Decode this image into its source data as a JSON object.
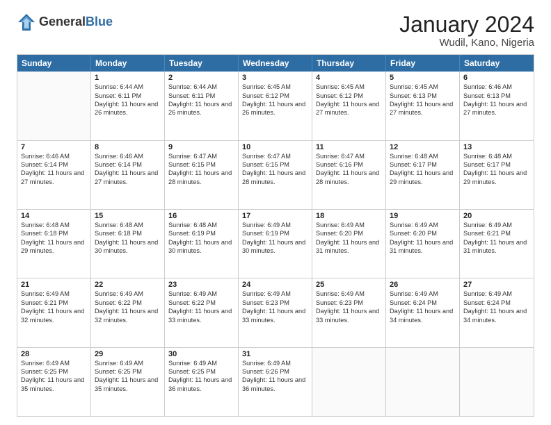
{
  "header": {
    "logo_general": "General",
    "logo_blue": "Blue",
    "month_title": "January 2024",
    "location": "Wudil, Kano, Nigeria"
  },
  "weekdays": [
    "Sunday",
    "Monday",
    "Tuesday",
    "Wednesday",
    "Thursday",
    "Friday",
    "Saturday"
  ],
  "rows": [
    [
      {
        "day": "",
        "sunrise": "",
        "sunset": "",
        "daylight": "",
        "empty": true
      },
      {
        "day": "1",
        "sunrise": "Sunrise: 6:44 AM",
        "sunset": "Sunset: 6:11 PM",
        "daylight": "Daylight: 11 hours and 26 minutes."
      },
      {
        "day": "2",
        "sunrise": "Sunrise: 6:44 AM",
        "sunset": "Sunset: 6:11 PM",
        "daylight": "Daylight: 11 hours and 26 minutes."
      },
      {
        "day": "3",
        "sunrise": "Sunrise: 6:45 AM",
        "sunset": "Sunset: 6:12 PM",
        "daylight": "Daylight: 11 hours and 26 minutes."
      },
      {
        "day": "4",
        "sunrise": "Sunrise: 6:45 AM",
        "sunset": "Sunset: 6:12 PM",
        "daylight": "Daylight: 11 hours and 27 minutes."
      },
      {
        "day": "5",
        "sunrise": "Sunrise: 6:45 AM",
        "sunset": "Sunset: 6:13 PM",
        "daylight": "Daylight: 11 hours and 27 minutes."
      },
      {
        "day": "6",
        "sunrise": "Sunrise: 6:46 AM",
        "sunset": "Sunset: 6:13 PM",
        "daylight": "Daylight: 11 hours and 27 minutes."
      }
    ],
    [
      {
        "day": "7",
        "sunrise": "Sunrise: 6:46 AM",
        "sunset": "Sunset: 6:14 PM",
        "daylight": "Daylight: 11 hours and 27 minutes."
      },
      {
        "day": "8",
        "sunrise": "Sunrise: 6:46 AM",
        "sunset": "Sunset: 6:14 PM",
        "daylight": "Daylight: 11 hours and 27 minutes."
      },
      {
        "day": "9",
        "sunrise": "Sunrise: 6:47 AM",
        "sunset": "Sunset: 6:15 PM",
        "daylight": "Daylight: 11 hours and 28 minutes."
      },
      {
        "day": "10",
        "sunrise": "Sunrise: 6:47 AM",
        "sunset": "Sunset: 6:15 PM",
        "daylight": "Daylight: 11 hours and 28 minutes."
      },
      {
        "day": "11",
        "sunrise": "Sunrise: 6:47 AM",
        "sunset": "Sunset: 6:16 PM",
        "daylight": "Daylight: 11 hours and 28 minutes."
      },
      {
        "day": "12",
        "sunrise": "Sunrise: 6:48 AM",
        "sunset": "Sunset: 6:17 PM",
        "daylight": "Daylight: 11 hours and 29 minutes."
      },
      {
        "day": "13",
        "sunrise": "Sunrise: 6:48 AM",
        "sunset": "Sunset: 6:17 PM",
        "daylight": "Daylight: 11 hours and 29 minutes."
      }
    ],
    [
      {
        "day": "14",
        "sunrise": "Sunrise: 6:48 AM",
        "sunset": "Sunset: 6:18 PM",
        "daylight": "Daylight: 11 hours and 29 minutes."
      },
      {
        "day": "15",
        "sunrise": "Sunrise: 6:48 AM",
        "sunset": "Sunset: 6:18 PM",
        "daylight": "Daylight: 11 hours and 30 minutes."
      },
      {
        "day": "16",
        "sunrise": "Sunrise: 6:48 AM",
        "sunset": "Sunset: 6:19 PM",
        "daylight": "Daylight: 11 hours and 30 minutes."
      },
      {
        "day": "17",
        "sunrise": "Sunrise: 6:49 AM",
        "sunset": "Sunset: 6:19 PM",
        "daylight": "Daylight: 11 hours and 30 minutes."
      },
      {
        "day": "18",
        "sunrise": "Sunrise: 6:49 AM",
        "sunset": "Sunset: 6:20 PM",
        "daylight": "Daylight: 11 hours and 31 minutes."
      },
      {
        "day": "19",
        "sunrise": "Sunrise: 6:49 AM",
        "sunset": "Sunset: 6:20 PM",
        "daylight": "Daylight: 11 hours and 31 minutes."
      },
      {
        "day": "20",
        "sunrise": "Sunrise: 6:49 AM",
        "sunset": "Sunset: 6:21 PM",
        "daylight": "Daylight: 11 hours and 31 minutes."
      }
    ],
    [
      {
        "day": "21",
        "sunrise": "Sunrise: 6:49 AM",
        "sunset": "Sunset: 6:21 PM",
        "daylight": "Daylight: 11 hours and 32 minutes."
      },
      {
        "day": "22",
        "sunrise": "Sunrise: 6:49 AM",
        "sunset": "Sunset: 6:22 PM",
        "daylight": "Daylight: 11 hours and 32 minutes."
      },
      {
        "day": "23",
        "sunrise": "Sunrise: 6:49 AM",
        "sunset": "Sunset: 6:22 PM",
        "daylight": "Daylight: 11 hours and 33 minutes."
      },
      {
        "day": "24",
        "sunrise": "Sunrise: 6:49 AM",
        "sunset": "Sunset: 6:23 PM",
        "daylight": "Daylight: 11 hours and 33 minutes."
      },
      {
        "day": "25",
        "sunrise": "Sunrise: 6:49 AM",
        "sunset": "Sunset: 6:23 PM",
        "daylight": "Daylight: 11 hours and 33 minutes."
      },
      {
        "day": "26",
        "sunrise": "Sunrise: 6:49 AM",
        "sunset": "Sunset: 6:24 PM",
        "daylight": "Daylight: 11 hours and 34 minutes."
      },
      {
        "day": "27",
        "sunrise": "Sunrise: 6:49 AM",
        "sunset": "Sunset: 6:24 PM",
        "daylight": "Daylight: 11 hours and 34 minutes."
      }
    ],
    [
      {
        "day": "28",
        "sunrise": "Sunrise: 6:49 AM",
        "sunset": "Sunset: 6:25 PM",
        "daylight": "Daylight: 11 hours and 35 minutes."
      },
      {
        "day": "29",
        "sunrise": "Sunrise: 6:49 AM",
        "sunset": "Sunset: 6:25 PM",
        "daylight": "Daylight: 11 hours and 35 minutes."
      },
      {
        "day": "30",
        "sunrise": "Sunrise: 6:49 AM",
        "sunset": "Sunset: 6:25 PM",
        "daylight": "Daylight: 11 hours and 36 minutes."
      },
      {
        "day": "31",
        "sunrise": "Sunrise: 6:49 AM",
        "sunset": "Sunset: 6:26 PM",
        "daylight": "Daylight: 11 hours and 36 minutes."
      },
      {
        "day": "",
        "sunrise": "",
        "sunset": "",
        "daylight": "",
        "empty": true
      },
      {
        "day": "",
        "sunrise": "",
        "sunset": "",
        "daylight": "",
        "empty": true
      },
      {
        "day": "",
        "sunrise": "",
        "sunset": "",
        "daylight": "",
        "empty": true
      }
    ]
  ]
}
